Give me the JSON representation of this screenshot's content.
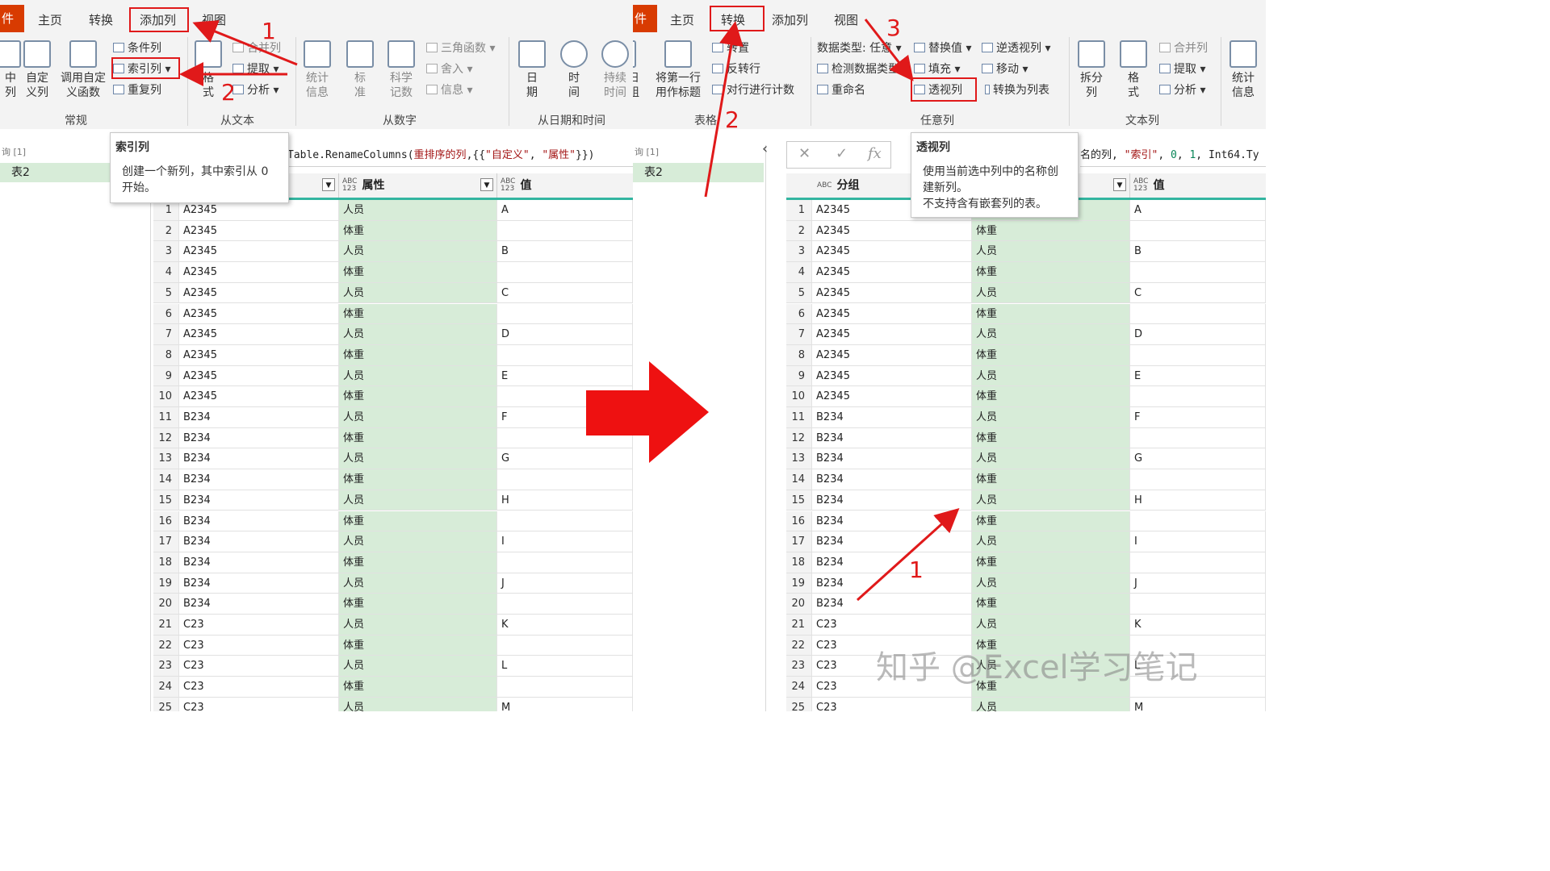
{
  "left": {
    "menu": {
      "file": "件",
      "home": "主页",
      "transform": "转换",
      "add_column": "添加列",
      "view": "视图"
    },
    "ribbon": {
      "general": {
        "label": "常规",
        "col_from_examples": "中\n列",
        "custom_column": "自定\n义列",
        "invoke_custom_function": "调用自定\n义函数",
        "conditional_column": "条件列",
        "index_column": "索引列",
        "duplicate_column": "重复列"
      },
      "from_text": {
        "label": "从文本",
        "format": "格\n式",
        "merge_columns": "合并列",
        "extract": "提取",
        "parse": "分析"
      },
      "from_number": {
        "label": "从数字",
        "statistics": "统计\n信息",
        "standard": "标\n准",
        "scientific": "科学\n记数",
        "trigonometry": "三角函数",
        "rounding": "舍入",
        "information": "信息"
      },
      "from_date_time": {
        "label": "从日期和时间",
        "date": "日\n期",
        "time": "时\n间",
        "duration": "持续\n时间"
      }
    },
    "query_pane": {
      "header": "询 [1]",
      "item": "表2"
    },
    "formula": {
      "prefix": "Table.RenameColumns(",
      "arg1": "重排序的列",
      "mid": ",{{",
      "s1": "\"自定义\"",
      "comma": ", ",
      "s2": "\"属性\"",
      "suffix": "}})"
    },
    "tooltip": {
      "title": "索引列",
      "line1": "创建一个新列，其中索引从 0",
      "line2": "开始。"
    },
    "columns": {
      "col2_type": "ABC\n123",
      "col2": "属性",
      "col3_type": "ABC\n123",
      "col3": "值"
    }
  },
  "right": {
    "menu": {
      "file": "件",
      "home": "主页",
      "transform": "转换",
      "add_column": "添加列",
      "view": "视图"
    },
    "ribbon": {
      "table": {
        "label": "表格",
        "transpose": "转置",
        "reverse_rows": "反转行",
        "count_rows": "对行进行计数",
        "use_first_row": "将第一行\n用作标题",
        "group_by": "日\n组"
      },
      "any_column": {
        "label": "任意列",
        "data_type": "数据类型: 任意",
        "detect_type": "检测数据类型",
        "rename": "重命名",
        "replace_values": "替换值",
        "fill": "填充",
        "pivot_column": "透视列",
        "unpivot": "逆透视列",
        "move": "移动",
        "to_list": "转换为列表"
      },
      "text_column": {
        "label": "文本列",
        "split_column": "拆分\n列",
        "format": "格\n式",
        "merge_columns": "合并列",
        "extract": "提取",
        "parse": "分析",
        "statistics": "统计\n信息"
      }
    },
    "query_pane": {
      "header": "询 [1]",
      "item": "表2"
    },
    "formula": {
      "prefix": "名的列",
      "comma": ", ",
      "s1": "\"索引\"",
      "n0": "0",
      "n1": "1",
      "suffix": "Int64.Ty"
    },
    "tooltip": {
      "title": "透视列",
      "line1": "使用当前选中列中的名称创",
      "line2": "建新列。",
      "line3": "不支持含有嵌套列的表。"
    },
    "columns": {
      "col1_type": "ABC",
      "col1": "分组",
      "col3_type": "ABC\n123",
      "col3": "值"
    }
  },
  "rows": [
    {
      "n": "1",
      "group": "A2345",
      "attr": "人员",
      "val": "A"
    },
    {
      "n": "2",
      "group": "A2345",
      "attr": "体重",
      "val": ""
    },
    {
      "n": "3",
      "group": "A2345",
      "attr": "人员",
      "val": "B"
    },
    {
      "n": "4",
      "group": "A2345",
      "attr": "体重",
      "val": ""
    },
    {
      "n": "5",
      "group": "A2345",
      "attr": "人员",
      "val": "C"
    },
    {
      "n": "6",
      "group": "A2345",
      "attr": "体重",
      "val": ""
    },
    {
      "n": "7",
      "group": "A2345",
      "attr": "人员",
      "val": "D"
    },
    {
      "n": "8",
      "group": "A2345",
      "attr": "体重",
      "val": ""
    },
    {
      "n": "9",
      "group": "A2345",
      "attr": "人员",
      "val": "E"
    },
    {
      "n": "10",
      "group": "A2345",
      "attr": "体重",
      "val": ""
    },
    {
      "n": "11",
      "group": "B234",
      "attr": "人员",
      "val": "F"
    },
    {
      "n": "12",
      "group": "B234",
      "attr": "体重",
      "val": ""
    },
    {
      "n": "13",
      "group": "B234",
      "attr": "人员",
      "val": "G"
    },
    {
      "n": "14",
      "group": "B234",
      "attr": "体重",
      "val": ""
    },
    {
      "n": "15",
      "group": "B234",
      "attr": "人员",
      "val": "H"
    },
    {
      "n": "16",
      "group": "B234",
      "attr": "体重",
      "val": ""
    },
    {
      "n": "17",
      "group": "B234",
      "attr": "人员",
      "val": "I"
    },
    {
      "n": "18",
      "group": "B234",
      "attr": "体重",
      "val": ""
    },
    {
      "n": "19",
      "group": "B234",
      "attr": "人员",
      "val": "J"
    },
    {
      "n": "20",
      "group": "B234",
      "attr": "体重",
      "val": ""
    },
    {
      "n": "21",
      "group": "C23",
      "attr": "人员",
      "val": "K"
    },
    {
      "n": "22",
      "group": "C23",
      "attr": "体重",
      "val": ""
    },
    {
      "n": "23",
      "group": "C23",
      "attr": "人员",
      "val": "L"
    },
    {
      "n": "24",
      "group": "C23",
      "attr": "体重",
      "val": ""
    },
    {
      "n": "25",
      "group": "C23",
      "attr": "人员",
      "val": "M"
    }
  ],
  "annotations": {
    "left_1": "1",
    "left_2": "2",
    "right_1": "1",
    "right_2": "2",
    "right_3": "3"
  },
  "watermark": "知乎 @Excel学习笔记",
  "colors": {
    "annotation_red": "#e0191a",
    "selected_column": "#d7ecd8",
    "header_accent": "#33b5a0",
    "big_arrow": "#ee1111"
  }
}
